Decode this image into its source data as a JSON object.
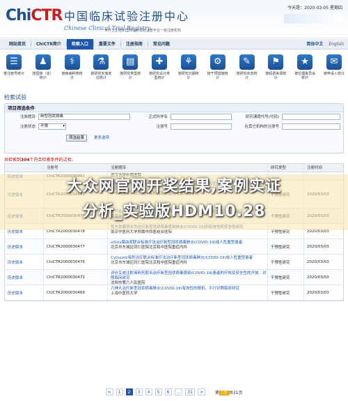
{
  "header": {
    "logo_prefix": "Chi",
    "logo_suffix": "CTR",
    "title_cn": "中国临床试验注册中心",
    "title_en": "Chinese Clinical Trial Registry",
    "sponsor": "世界卫生组织国际临床试验注册平台一级注册机构",
    "today_prefix": "今天是：",
    "today_date": "2020-03-05",
    "today_weekday": "星期四",
    "visit_count": "访问量"
  },
  "nav": {
    "items": [
      "网站首页",
      "ChiCTR简介",
      "检索入口",
      "重要文件",
      "注册指南",
      "常见问题"
    ],
    "active_index": 2,
    "lang_cn": "简体中文",
    "lang_en": "English"
  },
  "stats": [
    {
      "icon": "☰",
      "name": "by-registration-stat-icon",
      "label": "按注册号统计"
    },
    {
      "icon": "♟",
      "name": "by-country-stat-icon",
      "label": "按国家（省）统计"
    },
    {
      "icon": "⚕",
      "name": "by-disease-stat-icon",
      "label": "按疾病种类统计"
    },
    {
      "icon": "⚗",
      "name": "by-study-design-stat-icon",
      "label": "按研究实施单位统计"
    },
    {
      "icon": "▤",
      "name": "by-study-type-stat-icon",
      "label": "按研究类型统计"
    },
    {
      "icon": "✚",
      "name": "by-design-stat-icon",
      "label": "按研究设计类型统计"
    },
    {
      "icon": "⚘",
      "name": "by-phase-stat-icon",
      "label": "按研究分期统计"
    },
    {
      "icon": "⚙",
      "name": "by-measure-stat-icon",
      "label": "按干预措施统计"
    },
    {
      "icon": "✎",
      "name": "by-status-stat-icon",
      "label": "按研究状态统计"
    },
    {
      "icon": "⚑",
      "name": "by-sponsor-stat-icon",
      "label": "按经费来源统计"
    },
    {
      "icon": "★",
      "name": "by-ethics-stat-icon",
      "label": "按伦理委员会统计"
    },
    {
      "icon": "✉",
      "name": "by-contact-stat-icon",
      "label": "按申请人统计"
    }
  ],
  "search": {
    "section_title": "检索试验",
    "panel_title": "项目筛选条件",
    "label_title": "注册题目",
    "value_title": "新型冠状病毒",
    "label_scientific": "正式科学名",
    "label_sponsor": "研究课题代号(代码)",
    "label_status": "注册状态",
    "value_status": "不限",
    "label_regno": "注册号",
    "label_other": "在其它机构的注册号",
    "btn_filter": "筛选结果",
    "link_more": "更多选项"
  },
  "results": {
    "prefix": "共检索到",
    "count": "304",
    "suffix": "个符合检索条件的试验。",
    "headers": [
      "",
      "注册号",
      "注册题目",
      "研究类型",
      "注册时间"
    ],
    "rows": [
      {
        "hist": "历史版本",
        "regno": "ChiCTR2000030481",
        "title": "",
        "org": "武汉大学中南医院",
        "type": "",
        "date": ""
      },
      {
        "hist": "历史版本",
        "regno": "ChiCTR2000030480",
        "title": "重症人干扰素 α1β 治疗武汉新型冠状病毒感染患者的疗效和安全性随机、开放、空白对照的研究",
        "org": "华中科技大学同济医学院附属同济医院与重庆医学院",
        "type": "干预性研究",
        "date": "2020/03/03"
      },
      {
        "hist": "历史版本",
        "regno": "ChiCTR2000030479",
        "title": "益气化湿解毒方治疗新型冠状病毒感染肺炎(COVID-19)的有效性和安全性研究",
        "org": "南京中医药大学附属中西医结合医院",
        "type": "干预性研究",
        "date": "2020/03/03"
      },
      {
        "hist": "历史版本",
        "regno": "ChiCTR2000030478",
        "title": "复方鱼腥草合剂治疗新型冠状病毒感染肺炎(COVID-19)的有效性和安全性研究",
        "org": "南京中医药大学附属中西医结合医院",
        "type": "干预性研究",
        "date": "2020/03/03"
      },
      {
        "hist": "历史版本",
        "regno": "ChiCTR2000030477",
        "title": "oXiris膜血浆联合标准疗法治疗新型冠状病毒肺炎(COVID-19)成人危重型患者",
        "org": "北京市东城区同仁医院北京和中医院重症内科",
        "type": "干预性研究",
        "date": "2020/03/03"
      },
      {
        "hist": "历史版本",
        "regno": "ChiCTR2000030476",
        "title": "Cytosorb吸附治疗联合标准疗法治疗新型冠状病毒肺炎(COVID-19)成人危重型患者",
        "org": "北京市东城区同仁医院北京和中医院重症内科",
        "type": "干预性研究",
        "date": "2020/03/03"
      },
      {
        "hist": "历史版本",
        "regno": "ChiCTR2000030472",
        "title": "评价艾迪注射液利托那韦治疗新型冠状病毒感染(COVID-19)患者的疗效及安全性的开放、对照临床研究",
        "org": "沈阳市第六人民医院",
        "type": "干预性研究",
        "date": "2020/03/03"
      },
      {
        "hist": "历史版本",
        "regno": "ChiCTR2000030469",
        "title": "六神丸治疗新型冠状病毒肺炎(COVID-19)有效性的随机、平行对照临床研究",
        "org": "上海中医药大学",
        "type": "干预性研究",
        "date": "2020/03/03"
      }
    ]
  },
  "watermark": {
    "line1": "大众网官网开奖结果,案例实证",
    "line2": "分析_实验版HDM10.28"
  },
  "pager": {
    "pages": [
      "<",
      "1",
      "2",
      "3",
      "4",
      "5",
      "6",
      "...",
      "31",
      ">"
    ],
    "current": "2",
    "info_prefix": "第",
    "info_page": "2页",
    "info_total": "共31页"
  }
}
